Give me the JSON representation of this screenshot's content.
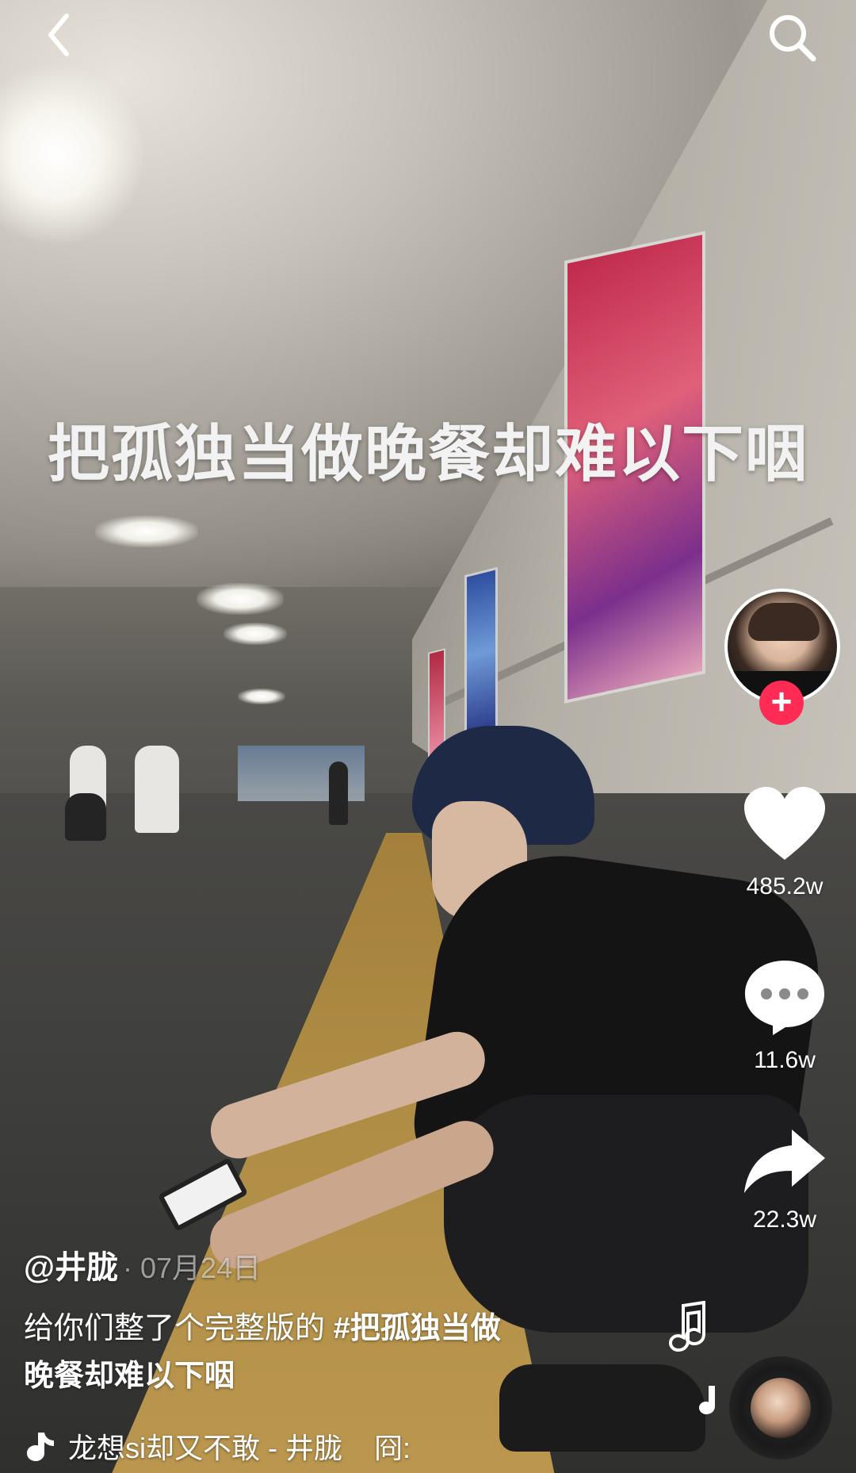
{
  "header": {
    "back_icon": "chevron-left-icon",
    "search_icon": "search-icon"
  },
  "video": {
    "overlay_text": "把孤独当做晚餐却难以下咽"
  },
  "sidebar": {
    "follow_label": "+",
    "like_count": "485.2w",
    "comment_count": "11.6w",
    "share_count": "22.3w"
  },
  "caption": {
    "author": "@井胧",
    "date": "· 07月24日",
    "text_before_tag": "给你们整了个完整版的 ",
    "hashtag_line1": "#把孤独当做",
    "hashtag_line2": "晚餐却难以下咽"
  },
  "music": {
    "title": "龙想si却又不敢 - 井胧",
    "extra": "冏:"
  },
  "colors": {
    "follow_accent": "#fe2c55",
    "text": "#ffffff"
  }
}
